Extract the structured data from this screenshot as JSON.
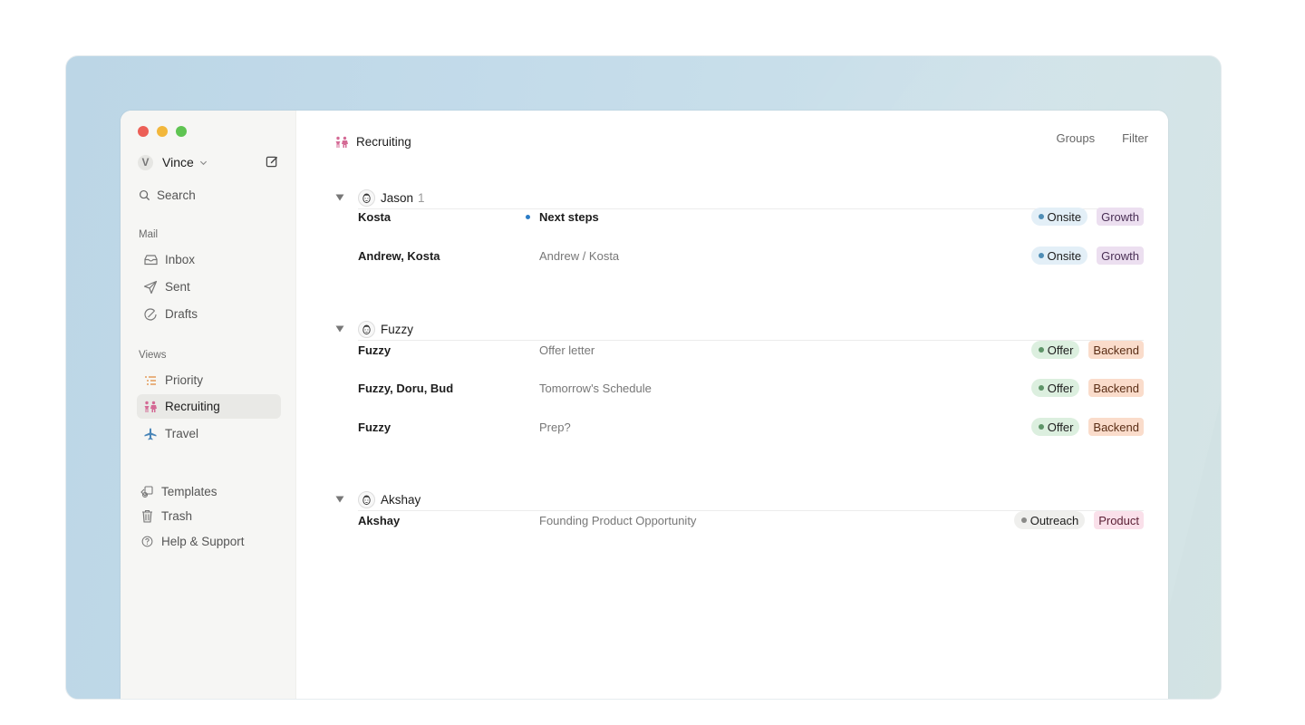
{
  "account": {
    "initial": "V",
    "name": "Vince"
  },
  "sidebar": {
    "search_label": "Search",
    "mail_section": "Mail",
    "mail_items": [
      {
        "label": "Inbox",
        "icon": "inbox-icon"
      },
      {
        "label": "Sent",
        "icon": "send-icon"
      },
      {
        "label": "Drafts",
        "icon": "drafts-icon"
      }
    ],
    "views_section": "Views",
    "view_items": [
      {
        "label": "Priority",
        "icon": "priority-list-icon",
        "color": "#e08a3c"
      },
      {
        "label": "Recruiting",
        "icon": "people-icon",
        "color": "#d46a95",
        "active": true
      },
      {
        "label": "Travel",
        "icon": "airplane-icon",
        "color": "#4a86b8"
      }
    ],
    "bottom_items": [
      {
        "label": "Templates",
        "icon": "templates-icon"
      },
      {
        "label": "Trash",
        "icon": "trash-icon"
      },
      {
        "label": "Help & Support",
        "icon": "help-icon"
      }
    ]
  },
  "main": {
    "title": "Recruiting",
    "toolbar": {
      "groups_label": "Groups",
      "filter_label": "Filter"
    },
    "groups": [
      {
        "name": "Jason",
        "count": "1",
        "rows": [
          {
            "from": "Kosta",
            "subject": "Next steps",
            "unread": true,
            "status": "Onsite",
            "label": "Growth"
          },
          {
            "from": "Andrew, Kosta",
            "subject": "Andrew / Kosta",
            "unread": false,
            "status": "Onsite",
            "label": "Growth"
          }
        ]
      },
      {
        "name": "Fuzzy",
        "count": "",
        "rows": [
          {
            "from": "Fuzzy",
            "subject": "Offer letter",
            "unread": false,
            "status": "Offer",
            "label": "Backend"
          },
          {
            "from": "Fuzzy, Doru, Bud",
            "subject": "Tomorrow's Schedule",
            "unread": false,
            "status": "Offer",
            "label": "Backend"
          },
          {
            "from": "Fuzzy",
            "subject": "Prep?",
            "unread": false,
            "status": "Offer",
            "label": "Backend"
          }
        ]
      },
      {
        "name": "Akshay",
        "count": "",
        "rows": [
          {
            "from": "Akshay",
            "subject": "Founding Product Opportunity",
            "unread": false,
            "status": "Outreach",
            "label": "Product"
          }
        ]
      }
    ]
  },
  "colors": {
    "status": {
      "Onsite": {
        "bg": "#e3eff7",
        "dot": "#4f8db5"
      },
      "Offer": {
        "bg": "#dcefdf",
        "dot": "#5e9468"
      },
      "Outreach": {
        "bg": "#efefed",
        "dot": "#8a8a88"
      }
    },
    "labels": {
      "Growth": {
        "bg": "#ecdff0",
        "fg": "#4a2f55"
      },
      "Backend": {
        "bg": "#fadccb",
        "fg": "#5a2d15"
      },
      "Product": {
        "bg": "#fae0ea",
        "fg": "#5b2035"
      }
    }
  }
}
